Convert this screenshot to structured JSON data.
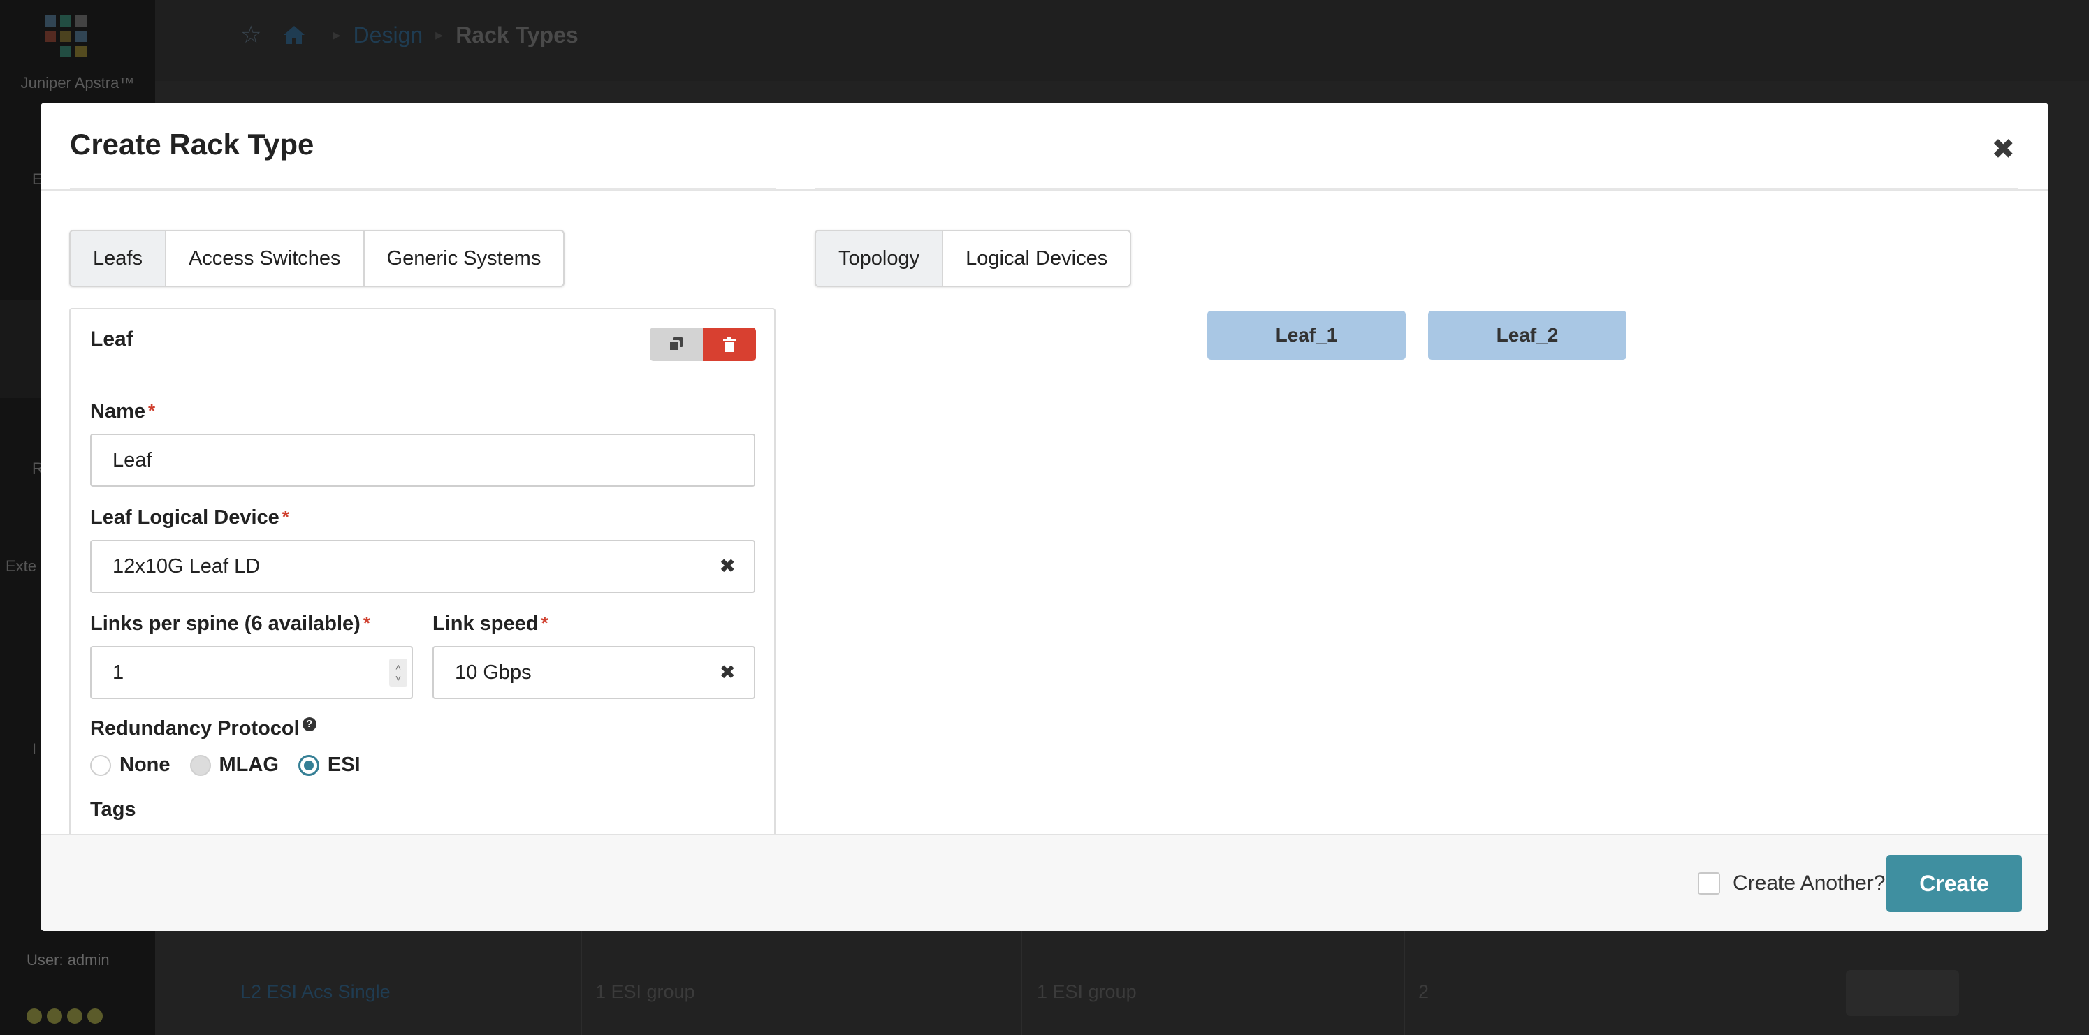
{
  "app": {
    "brand": "Juniper Apstra™",
    "user": "User: admin"
  },
  "sidebar_fragments": [
    "E",
    "R",
    "Exte",
    "I"
  ],
  "breadcrumb": {
    "parent": "Design",
    "current": "Rack Types"
  },
  "background_row": {
    "name": "L2 ESI Acs Single",
    "col2": "1 ESI group",
    "col3": "1 ESI group",
    "col4": "2"
  },
  "modal": {
    "title": "Create Rack Type",
    "left_tabs": [
      {
        "label": "Leafs",
        "active": true
      },
      {
        "label": "Access Switches",
        "active": false
      },
      {
        "label": "Generic Systems",
        "active": false
      }
    ],
    "right_tabs": [
      {
        "label": "Topology",
        "active": true
      },
      {
        "label": "Logical Devices",
        "active": false
      }
    ],
    "leaf_panel": {
      "title": "Leaf",
      "name_label": "Name",
      "name_value": "Leaf",
      "logical_device_label": "Leaf Logical Device",
      "logical_device_value": "12x10G Leaf LD",
      "links_label": "Links per spine (6 available)",
      "links_value": "1",
      "link_speed_label": "Link speed",
      "link_speed_value": "10 Gbps",
      "redundancy_label": "Redundancy Protocol",
      "redundancy_options": [
        {
          "label": "None",
          "state": "unchecked"
        },
        {
          "label": "MLAG",
          "state": "disabled"
        },
        {
          "label": "ESI",
          "state": "checked"
        }
      ],
      "selected_redundancy": "ESI",
      "tags_label": "Tags"
    },
    "topology_nodes": [
      "Leaf_1",
      "Leaf_2"
    ],
    "footer": {
      "create_another_label": "Create Another?",
      "create_another_checked": false,
      "create_label": "Create"
    }
  },
  "colors": {
    "accent": "#3f8fa0",
    "danger": "#d84030",
    "node_fill": "#a9c7e4",
    "required": "#d0402f"
  },
  "icons": {
    "close": "close-icon",
    "copy": "copy-icon",
    "delete": "trash-icon",
    "clear": "clear-icon",
    "help": "help-icon",
    "home": "home-icon",
    "star": "star-icon"
  }
}
